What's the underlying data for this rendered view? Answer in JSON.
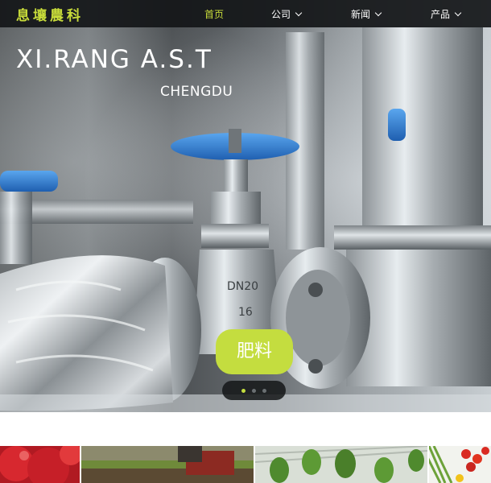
{
  "nav": {
    "logo": "息壤農科",
    "items": [
      {
        "label": "首页",
        "active": true,
        "has_dropdown": false
      },
      {
        "label": "公司",
        "active": false,
        "has_dropdown": true
      },
      {
        "label": "新闻",
        "active": false,
        "has_dropdown": true
      },
      {
        "label": "产品",
        "active": false,
        "has_dropdown": true
      }
    ]
  },
  "hero": {
    "brand_text": "XI.RANG A.S.T",
    "city_text": "CHENGDU",
    "cta_label": "肥料",
    "slides_total": 3,
    "slide_active": 1
  },
  "colors": {
    "accent": "#c4dd3f",
    "nav_bg": "#141618",
    "valve_blue": "#2f7fd0"
  },
  "thumbnails": [
    {
      "icon": "fruit-image"
    },
    {
      "icon": "farm-soil-image"
    },
    {
      "icon": "greenhouse-plants-image"
    },
    {
      "icon": "tomato-plant-image"
    }
  ]
}
